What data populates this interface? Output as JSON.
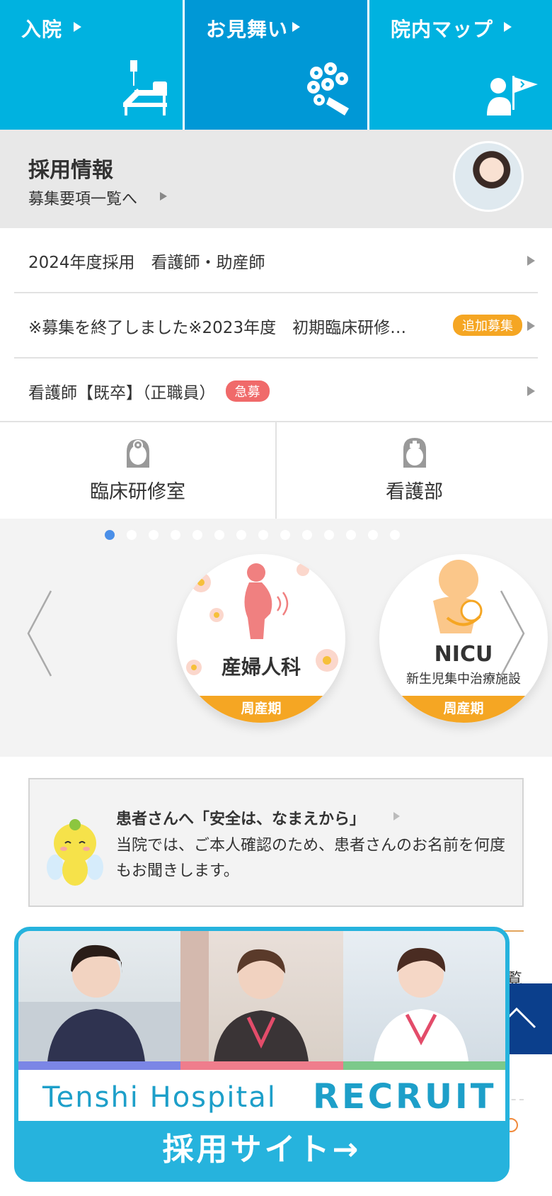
{
  "topnav": {
    "items": [
      {
        "label": "入院",
        "icon": "hospital-bed-icon"
      },
      {
        "label": "お見舞い",
        "icon": "flower-bouquet-icon"
      },
      {
        "label": "院内マップ",
        "icon": "guide-flag-person-icon"
      }
    ]
  },
  "recruit": {
    "title": "採用情報",
    "sub_link": "募集要項一覧へ"
  },
  "jobs": [
    {
      "text": "2024年度採用　看護師・助産師",
      "badge": ""
    },
    {
      "text": "※募集を終了しました※2023年度　初期臨床研修…",
      "badge": "追加募集"
    },
    {
      "text": "看護師【既卒】（正職員）",
      "badge": "急募"
    }
  ],
  "departments": [
    {
      "label": "臨床研修室",
      "icon": "doctor-head-icon"
    },
    {
      "label": "看護部",
      "icon": "nurse-head-icon"
    }
  ],
  "carousel": {
    "dot_count": 14,
    "active_dot": 1,
    "cards": [
      {
        "name": "産婦人科",
        "sub": "",
        "band": "周産期",
        "icon": "pregnant-woman-icon"
      },
      {
        "name": "NICU",
        "sub": "新生児集中治療施設",
        "band": "周産期",
        "icon": "mother-baby-icon"
      }
    ]
  },
  "notice": {
    "title": "患者さんへ「安全は、なまえから」",
    "body": "当院では、ご本人確認のため、患者さんのお名前を何度もお聞きします。",
    "mascot": "angel-mascot-icon"
  },
  "peek": {
    "text": "覧"
  },
  "banner": {
    "hospital": "Tenshi Hospital",
    "recruit": "RECRUIT",
    "cta": "採用サイト→"
  },
  "colors": {
    "nav": "#00b2e0",
    "nav_active": "#0098d6",
    "badge_orange": "#f5a623",
    "badge_red": "#f06a6a",
    "to_top": "#0b3f8c",
    "banner": "#26b3dd"
  }
}
